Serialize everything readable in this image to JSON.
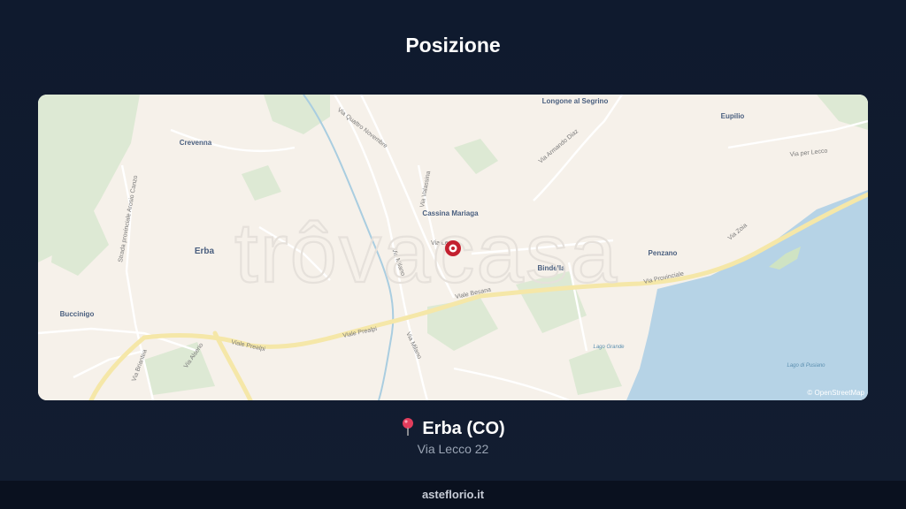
{
  "header": {
    "title": "Posizione"
  },
  "map": {
    "watermark": "trôvacasa",
    "attribution": "© OpenStreetMap",
    "places": {
      "longone": "Longone al Segrino",
      "eupilio": "Eupilio",
      "crevenna": "Crevenna",
      "cassina": "Cassina Mariaga",
      "erba": "Erba",
      "bindella": "Bindella",
      "penzano": "Penzano",
      "buccinigo": "Buccinigo"
    },
    "roads": {
      "besana": "Viale Besana",
      "prealpi": "Viale Prealpi",
      "milano": "Via Milano",
      "provinciale": "Via Provinciale",
      "lecco": "Via per Lecco",
      "zoia": "Via Zoia",
      "armando_diaz": "Via Armando Diaz",
      "quattro_novembre": "Via Quattro Novembre",
      "valassina": "Via Valassina",
      "lecco_short": "Via Lecco",
      "briantea": "Via Briantea",
      "alserio": "Via Alserio",
      "arosio": "Strada provinciale Arosio Canzo"
    },
    "water": {
      "pusiano": "Lago di Pusiano",
      "lago_grande": "Lago Grande"
    },
    "colors": {
      "background": "#f6f1ea",
      "green": "#dde9d4",
      "water": "#b6d3e6",
      "main_road": "#f5e7a8",
      "marker": "#c3202f"
    }
  },
  "location": {
    "pin_icon": "map-pin-icon",
    "name": "Erba (CO)",
    "address": "Via Lecco 22"
  },
  "footer": {
    "site": "asteflorio.it"
  }
}
